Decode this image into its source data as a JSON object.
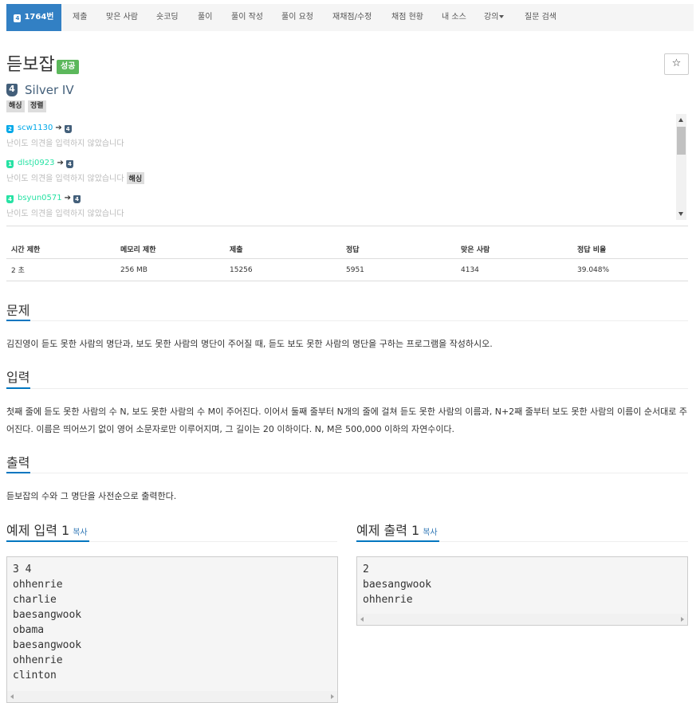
{
  "nav": {
    "active": "1764번",
    "items": [
      "제출",
      "맞은 사람",
      "숏코딩",
      "풀이",
      "풀이 작성",
      "풀이 요청",
      "재채점/수정",
      "채점 현황",
      "내 소스",
      "강의",
      "질문 검색"
    ]
  },
  "problem": {
    "title": "듣보잡",
    "result_badge": "성공",
    "star": "☆",
    "tier_number": "4",
    "tier": "Silver IV",
    "tags": [
      "해싱",
      "정렬"
    ]
  },
  "opinions": [
    {
      "user": "scw1130",
      "from_tier": "2",
      "to_tier": "4",
      "note": "난이도 의견을 입력하지 않았습니다",
      "tag": "",
      "color": "#00a8e8"
    },
    {
      "user": "dlstj0923",
      "from_tier": "1",
      "to_tier": "4",
      "note": "난이도 의견을 입력하지 않았습니다",
      "tag": "해싱",
      "color": "#27e2a4"
    },
    {
      "user": "bsyun0571",
      "from_tier": "4",
      "to_tier": "4",
      "note": "난이도 의견을 입력하지 않았습니다",
      "tag": "",
      "color": "#27e2a4"
    }
  ],
  "info_table": {
    "headers": [
      "시간 제한",
      "메모리 제한",
      "제출",
      "정답",
      "맞은 사람",
      "정답 비율"
    ],
    "values": [
      "2 초",
      "256 MB",
      "15256",
      "5951",
      "4134",
      "39.048%"
    ]
  },
  "sections": {
    "problem_heading": "문제",
    "problem_text": "김진영이 듣도 못한 사람의 명단과, 보도 못한 사람의 명단이 주어질 때, 듣도 보도 못한 사람의 명단을 구하는 프로그램을 작성하시오.",
    "input_heading": "입력",
    "input_text": "첫째 줄에 듣도 못한 사람의 수 N, 보도 못한 사람의 수 M이 주어진다. 이어서 둘째 줄부터 N개의 줄에 걸쳐 듣도 못한 사람의 이름과, N+2째 줄부터 보도 못한 사람의 이름이 순서대로 주어진다. 이름은 띄어쓰기 없이 영어 소문자로만 이루어지며, 그 길이는 20 이하이다. N, M은 500,000 이하의 자연수이다.",
    "output_heading": "출력",
    "output_text": "듣보잡의 수와 그 명단을 사전순으로 출력한다."
  },
  "examples": {
    "input_heading": "예제 입력 1",
    "output_heading": "예제 출력 1",
    "copy_label": "복사",
    "input_lines": "3 4\nohhenrie\ncharlie\nbaesangwook\nobama\nbaesangwook\nohhenrie\nclinton",
    "output_lines": "2\nbaesangwook\nohhenrie"
  }
}
